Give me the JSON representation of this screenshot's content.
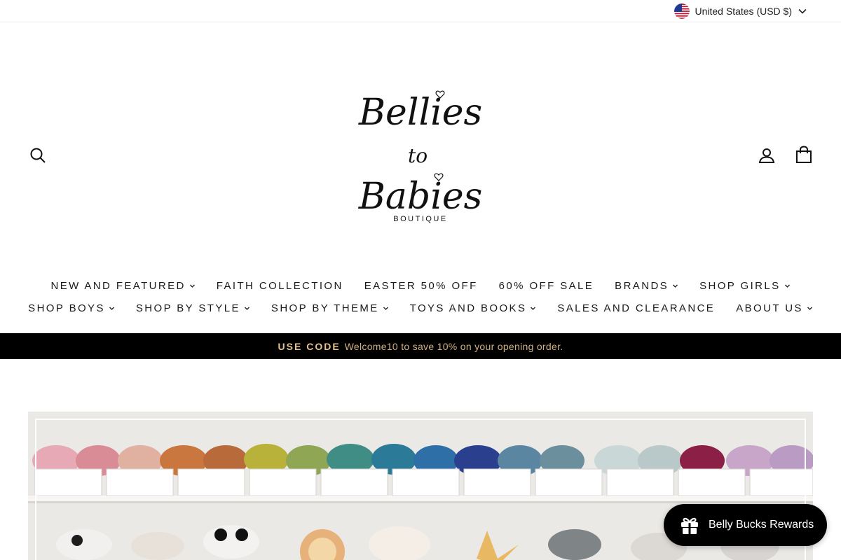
{
  "locale": {
    "label": "United States (USD $)",
    "flag_icon": "us-flag-icon"
  },
  "header": {
    "logo": {
      "line1": "Bellies",
      "line2": "to",
      "line3": "Babies",
      "line4": "BOUTIQUE"
    },
    "icons": [
      "search-icon",
      "account-icon",
      "cart-icon"
    ]
  },
  "nav": {
    "row1": [
      {
        "label": "NEW AND FEATURED",
        "dropdown": true
      },
      {
        "label": "FAITH COLLECTION",
        "dropdown": false
      },
      {
        "label": "EASTER 50% OFF",
        "dropdown": false
      },
      {
        "label": "60% OFF SALE",
        "dropdown": false
      },
      {
        "label": "BRANDS",
        "dropdown": true
      },
      {
        "label": "SHOP GIRLS",
        "dropdown": true
      }
    ],
    "row2": [
      {
        "label": "SHOP BOYS",
        "dropdown": true
      },
      {
        "label": "SHOP BY STYLE",
        "dropdown": true
      },
      {
        "label": "SHOP BY THEME",
        "dropdown": true
      },
      {
        "label": "TOYS AND BOOKS",
        "dropdown": true
      },
      {
        "label": "SALES AND CLEARANCE",
        "dropdown": false
      },
      {
        "label": "ABOUT US",
        "dropdown": true
      }
    ]
  },
  "announcement": {
    "code_label": "USE CODE",
    "message": "Welcome10 to save 10% on your opening order."
  },
  "rewards": {
    "label": "Belly Bucks Rewards",
    "icon": "gift-icon"
  },
  "colors": {
    "announcement_bg": "#000000",
    "announcement_text": "#d2b080",
    "rewards_bg": "#000000"
  }
}
